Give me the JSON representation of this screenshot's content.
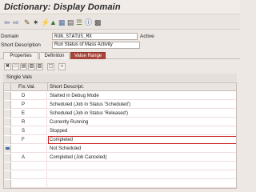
{
  "window": {
    "title": "Dictionary: Display Domain"
  },
  "toolbar": {
    "icons": [
      "back-arrow",
      "forward-arrow",
      "display-change",
      "check",
      "activate",
      "where-used",
      "object-list",
      "display-object",
      "hierarchy",
      "info",
      "other"
    ]
  },
  "header": {
    "domain_label": "Domain",
    "domain_value": "RUN_STATUS_MX",
    "domain_status": "Active",
    "short_desc_label": "Short Description",
    "short_desc_value": "Run Status of Mass Activity"
  },
  "tabs": [
    {
      "label": "Properties",
      "active": false
    },
    {
      "label": "Definition",
      "active": false
    },
    {
      "label": "Value Range",
      "active": true
    }
  ],
  "grid": {
    "title": "Single Vals",
    "columns": [
      "Fix.Val.",
      "Short Descript."
    ],
    "rows": [
      {
        "value": "D",
        "description": "Started in Debug Mode",
        "marked": false
      },
      {
        "value": "P",
        "description": "Scheduled (Job in Status 'Scheduled')",
        "marked": false
      },
      {
        "value": "E",
        "description": "Scheduled (Job in Status 'Released')",
        "marked": false
      },
      {
        "value": "R",
        "description": "Currently Running",
        "marked": false
      },
      {
        "value": "S",
        "description": "Stopped",
        "marked": false
      },
      {
        "value": "F",
        "description": "Completed",
        "marked": false
      },
      {
        "value": "",
        "description": "Not Scheduled",
        "marked": true
      },
      {
        "value": "A",
        "description": "Completed (Job Canceled)",
        "marked": false
      },
      {
        "value": "",
        "description": "",
        "marked": false
      },
      {
        "value": "",
        "description": "",
        "marked": false
      },
      {
        "value": "",
        "description": "",
        "marked": false
      },
      {
        "value": "",
        "description": "",
        "marked": false
      }
    ]
  },
  "colors": {
    "active_tab": "#a8453a",
    "marker": "#3a6ea5"
  }
}
